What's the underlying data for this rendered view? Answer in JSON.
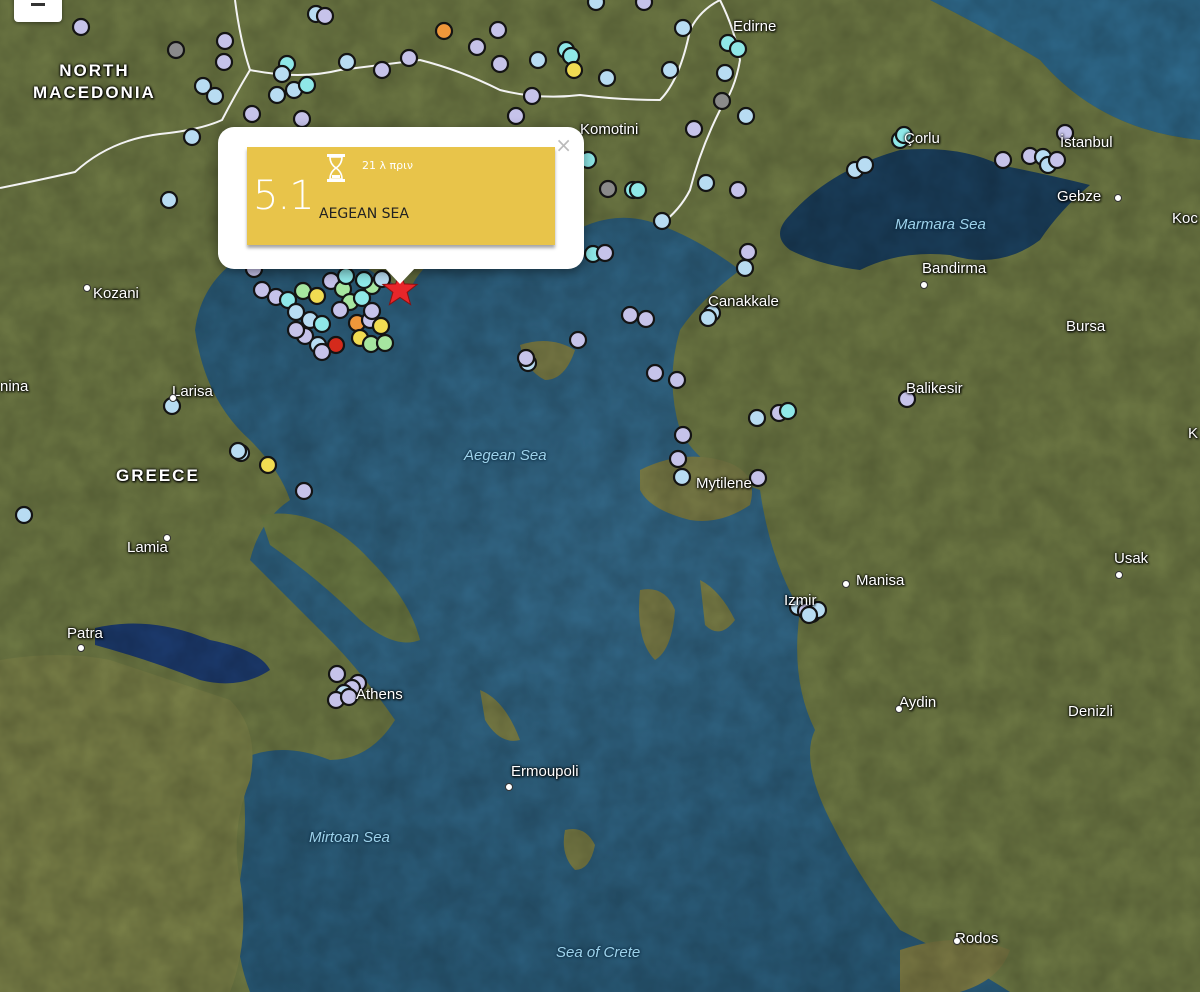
{
  "labels": [
    {
      "id": "north-macedonia",
      "text": "NORTH\nMACEDONIA",
      "type": "country"
    },
    {
      "id": "greece",
      "text": "GREECE",
      "type": "country"
    },
    {
      "id": "edirne",
      "text": "Edirne",
      "type": "city"
    },
    {
      "id": "komotini",
      "text": "Komotini",
      "type": "city"
    },
    {
      "id": "corlu",
      "text": "Çorlu",
      "type": "city"
    },
    {
      "id": "istanbul",
      "text": "İstanbul",
      "type": "city"
    },
    {
      "id": "gebze",
      "text": "Gebze",
      "type": "city"
    },
    {
      "id": "koc",
      "text": "Koc",
      "type": "city"
    },
    {
      "id": "marmara-sea",
      "text": "Marmara Sea",
      "type": "sea"
    },
    {
      "id": "bandirma",
      "text": "Bandirma",
      "type": "city"
    },
    {
      "id": "bursa",
      "text": "Bursa",
      "type": "city"
    },
    {
      "id": "canakkale",
      "text": "Canakkale",
      "type": "city"
    },
    {
      "id": "kozani",
      "text": "Kozani",
      "type": "city"
    },
    {
      "id": "larisa",
      "text": "Larisa",
      "type": "city"
    },
    {
      "id": "nina",
      "text": "nina",
      "type": "city"
    },
    {
      "id": "balikesir",
      "text": "Balikesir",
      "type": "city"
    },
    {
      "id": "aegean-sea",
      "text": "Aegean Sea",
      "type": "sea"
    },
    {
      "id": "mytilene",
      "text": "Mytilene",
      "type": "city"
    },
    {
      "id": "lamia",
      "text": "Lamia",
      "type": "city"
    },
    {
      "id": "usak",
      "text": "Usak",
      "type": "city"
    },
    {
      "id": "manisa",
      "text": "Manisa",
      "type": "city"
    },
    {
      "id": "izmir",
      "text": "Izmir",
      "type": "city"
    },
    {
      "id": "patra",
      "text": "Patra",
      "type": "city"
    },
    {
      "id": "athens",
      "text": "Athens",
      "type": "city"
    },
    {
      "id": "aydin",
      "text": "Aydin",
      "type": "city"
    },
    {
      "id": "denizli",
      "text": "Denizli",
      "type": "city"
    },
    {
      "id": "ermoupoli",
      "text": "Ermoupoli",
      "type": "city"
    },
    {
      "id": "mirtoan-sea",
      "text": "Mirtoan Sea",
      "type": "sea"
    },
    {
      "id": "sea-of-crete",
      "text": "Sea of Crete",
      "type": "sea"
    },
    {
      "id": "rodos",
      "text": "Rodos",
      "type": "city"
    },
    {
      "id": "k-edge",
      "text": "K",
      "type": "city"
    }
  ],
  "popup": {
    "magnitude": "5.1",
    "time_ago": "21 λ πριν",
    "region": "AEGEAN SEA",
    "close_symbol": "×",
    "card_color": "#e8c44a"
  },
  "legend_colors": {
    "lavender": "#c6c3ea",
    "light_blue": "#b8dcf2",
    "cyan": "#8fe8e8",
    "light_green": "#a6e6a0",
    "yellow": "#f1dc52",
    "orange": "#f0973a",
    "red": "#d42a1c",
    "gray": "#8a8a8a"
  },
  "epicenter_color": "#e8262a"
}
